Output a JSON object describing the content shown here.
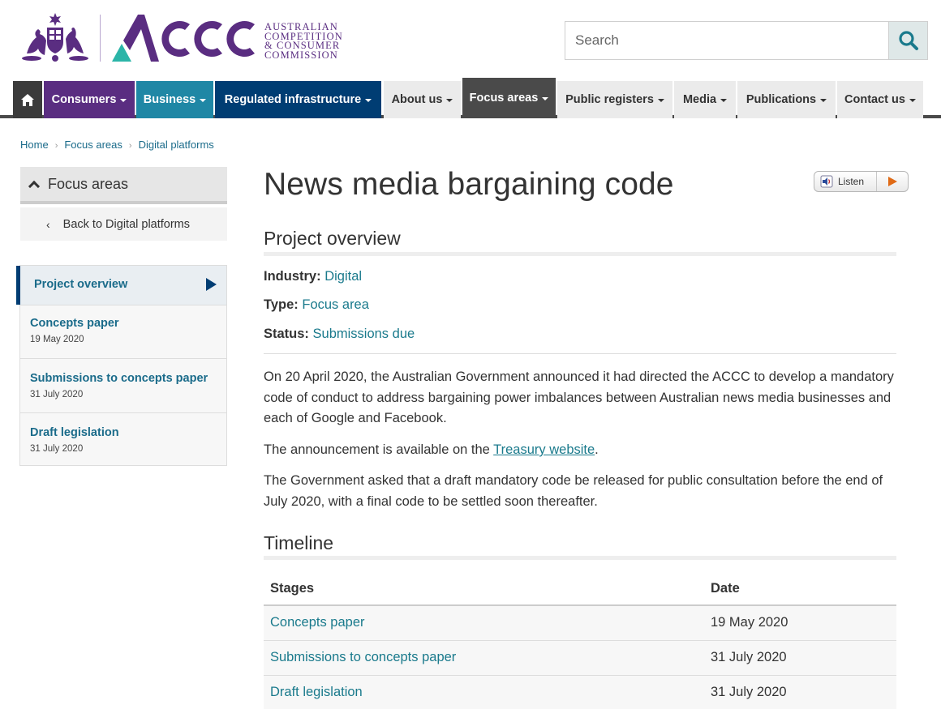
{
  "header": {
    "logo_text_lines": [
      "AUSTRALIAN",
      "COMPETITION",
      "& CONSUMER",
      "COMMISSION"
    ],
    "logo_mark": "ACCC",
    "search_placeholder": "Search",
    "colors": {
      "brand_purple": "#5a2d81",
      "brand_teal": "#2bb5a8"
    }
  },
  "nav": {
    "items": [
      {
        "label": "Consumers",
        "color": "#5a2d81"
      },
      {
        "label": "Business",
        "color": "#1f87a5"
      },
      {
        "label": "Regulated infrastructure",
        "color": "#003d73"
      },
      {
        "label": "About us"
      },
      {
        "label": "Focus areas",
        "active": true
      },
      {
        "label": "Public registers"
      },
      {
        "label": "Media"
      },
      {
        "label": "Publications"
      },
      {
        "label": "Contact us"
      }
    ]
  },
  "breadcrumb": [
    "Home",
    "Focus areas",
    "Digital platforms"
  ],
  "sidebar": {
    "heading": "Focus areas",
    "back_label": "Back to Digital platforms",
    "items": [
      {
        "title": "Project overview",
        "date": "",
        "active": true
      },
      {
        "title": "Concepts paper",
        "date": "19 May 2020"
      },
      {
        "title": "Submissions to concepts paper",
        "date": "31 July 2020"
      },
      {
        "title": "Draft legislation",
        "date": "31 July 2020"
      }
    ]
  },
  "main": {
    "title": "News media bargaining code",
    "listen_label": "Listen",
    "overview_heading": "Project overview",
    "meta": [
      {
        "label": "Industry:",
        "value": "Digital"
      },
      {
        "label": "Type:",
        "value": "Focus area"
      },
      {
        "label": "Status:",
        "value": "Submissions due"
      }
    ],
    "paragraphs": {
      "p1": "On 20 April 2020, the Australian Government announced it had directed the ACCC to develop a mandatory code of conduct to address bargaining power imbalances between Australian news media businesses and each of Google and Facebook.",
      "p2_before": "The announcement is available on the ",
      "p2_link": "Treasury website",
      "p2_after": ".",
      "p3": "The Government asked that a draft mandatory code be released for public consultation before the end of July 2020, with a final code to be settled soon thereafter."
    },
    "timeline_heading": "Timeline",
    "timeline": {
      "headers": [
        "Stages",
        "Date"
      ],
      "rows": [
        {
          "stage": "Concepts paper",
          "date": "19 May 2020"
        },
        {
          "stage": "Submissions to concepts paper",
          "date": "31 July 2020"
        },
        {
          "stage": "Draft legislation",
          "date": "31 July 2020"
        }
      ]
    }
  }
}
